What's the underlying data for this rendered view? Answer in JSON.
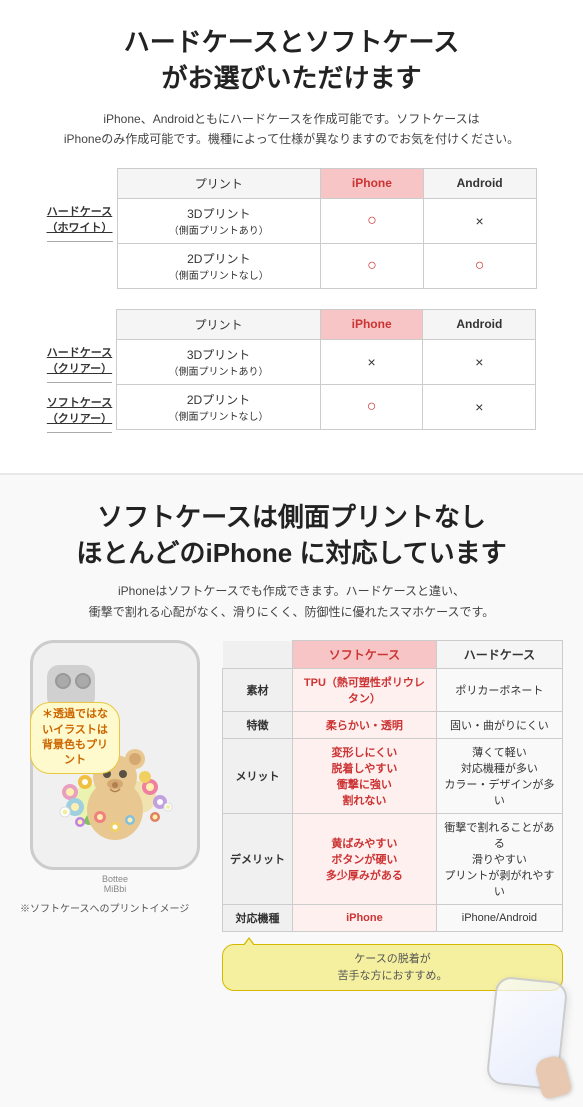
{
  "top": {
    "title": "ハードケースとソフトケース\nがお選びいただけます",
    "subtitle": "iPhone、Androidともにハードケースを作成可能です。ソフトケースは\niPhoneのみ作成可能です。機種によって仕様が異なりますのでお気を付けください。",
    "table1": {
      "label": "ハードケース\n（ホワイト）",
      "header": [
        "プリント",
        "iPhone",
        "Android"
      ],
      "rows": [
        {
          "print": "3Dプリント\n（側面プリントあり）",
          "iphone": "○",
          "android": "×"
        },
        {
          "print": "2Dプリント\n（側面プリントなし）",
          "iphone": "○",
          "android": "○"
        }
      ]
    },
    "table2_labels": [
      "ハードケース\n（クリアー）",
      "ソフトケース\n（クリアー）"
    ],
    "table2": {
      "header": [
        "プリント",
        "iPhone",
        "Android"
      ],
      "rows": [
        {
          "print": "3Dプリント\n（側面プリントあり）",
          "iphone": "×",
          "android": "×"
        },
        {
          "print": "2Dプリント\n（側面プリントなし）",
          "iphone": "○",
          "android": "×"
        }
      ]
    }
  },
  "bottom": {
    "title": "ソフトケースは側面プリントなし\nほとんどのiPhoneに対応しています",
    "subtitle": "iPhoneはソフトケースでも作成できます。ハードケースと違い、\n衝撃で割れる心配がなく、滑りにくく、防御性に優れたスマホケースです。",
    "transparent_label": "＊透過ではないイラストは\n背景色もプリント",
    "phone_brand": "Bottee\nMiBbi",
    "phone_note": "※ソフトケースへのプリントイメージ",
    "balloon_text": "ケースの脱着が\n苦手な方におすすめ。",
    "feature_table": {
      "headers": [
        "ソフトケース",
        "ハードケース"
      ],
      "rows": [
        {
          "label": "素材",
          "soft": "TPU（熱可塑性ポリウレタン）",
          "hard": "ポリカーボネート"
        },
        {
          "label": "特徴",
          "soft": "柔らかい・透明",
          "hard": "固い・曲がりにくい"
        },
        {
          "label": "メリット",
          "soft": "変形しにくい\n脱着しやすい\n衝撃に強い\n割れない",
          "hard": "薄くて軽い\n対応機種が多い\nカラー・デザインが多い"
        },
        {
          "label": "デメリット",
          "soft": "黄ばみやすい\nボタンが硬い\n多少厚みがある",
          "hard": "衝撃で割れることがある\n滑りやすい\nプリントが剥がれやすい"
        },
        {
          "label": "対応機種",
          "soft": "iPhone",
          "hard": "iPhone/Android"
        }
      ]
    }
  }
}
